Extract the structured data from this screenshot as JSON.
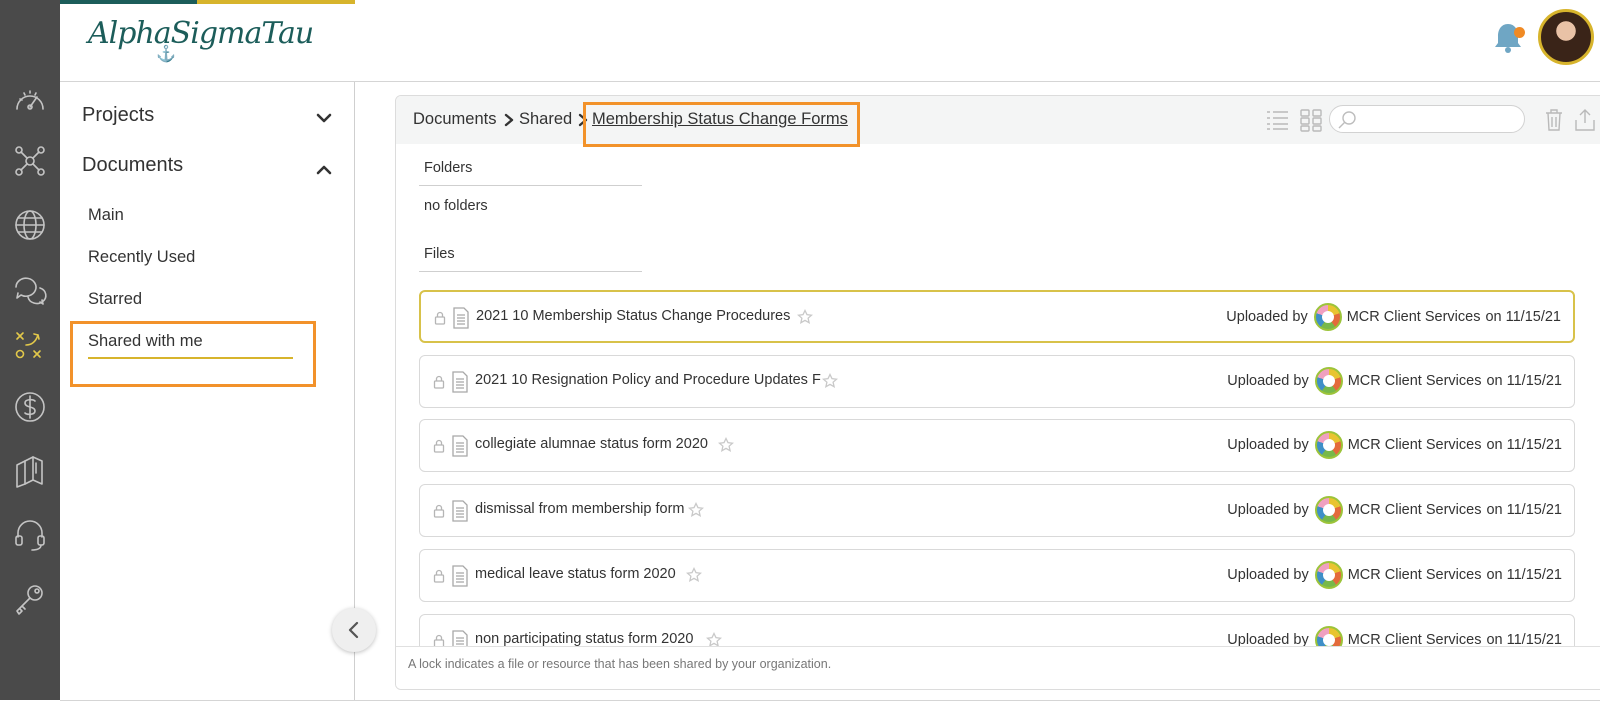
{
  "brand": {
    "logo_text": "AlphaSigmaTau",
    "primary_color": "#1c5d5a",
    "accent_color": "#d7b42c",
    "highlight_color": "#f2922a"
  },
  "rail": [
    {
      "icon": "speedometer-icon"
    },
    {
      "icon": "network-icon"
    },
    {
      "icon": "globe-icon"
    },
    {
      "icon": "chat-bubbles-icon"
    },
    {
      "icon": "strategy-icon",
      "active": true
    },
    {
      "icon": "dollar-icon"
    },
    {
      "icon": "books-icon"
    },
    {
      "icon": "headset-icon"
    },
    {
      "icon": "key-icon"
    }
  ],
  "header": {
    "notification_icon": "bell-icon",
    "notification_dot_color": "#f08a24",
    "avatar_icon": "user-avatar"
  },
  "nav": {
    "sections": [
      {
        "label": "Projects",
        "expanded": false
      },
      {
        "label": "Documents",
        "expanded": true
      }
    ],
    "items": [
      "Main",
      "Recently Used",
      "Starred",
      "Shared with me"
    ],
    "active_item": "Shared with me"
  },
  "breadcrumb": [
    "Documents",
    "Shared",
    "Membership Status Change Forms"
  ],
  "toolbar": {
    "search_value": "",
    "icons": [
      "list-view-icon",
      "grid-view-icon",
      "search-icon",
      "trash-icon",
      "upload-icon"
    ]
  },
  "folders": {
    "label": "Folders",
    "empty_text": "no folders"
  },
  "files": {
    "label": "Files",
    "uploaded_by_label": "Uploaded by",
    "on_label": "on",
    "rows": [
      {
        "name": "2021 10 Membership Status Change Procedures",
        "uploader": "MCR Client Services",
        "date": "11/15/21",
        "selected": true
      },
      {
        "name": "2021 10 Resignation Policy and Procedure Updates F",
        "uploader": "MCR Client Services",
        "date": "11/15/21",
        "selected": false
      },
      {
        "name": "collegiate alumnae status form 2020",
        "uploader": "MCR Client Services",
        "date": "11/15/21",
        "selected": false
      },
      {
        "name": "dismissal from membership form",
        "uploader": "MCR Client Services",
        "date": "11/15/21",
        "selected": false
      },
      {
        "name": "medical leave status form 2020",
        "uploader": "MCR Client Services",
        "date": "11/15/21",
        "selected": false
      },
      {
        "name": "non participating status form 2020",
        "uploader": "MCR Client Services",
        "date": "11/15/21",
        "selected": false
      }
    ]
  },
  "footnote": "A lock indicates a file or resource that has been shared by your organization."
}
